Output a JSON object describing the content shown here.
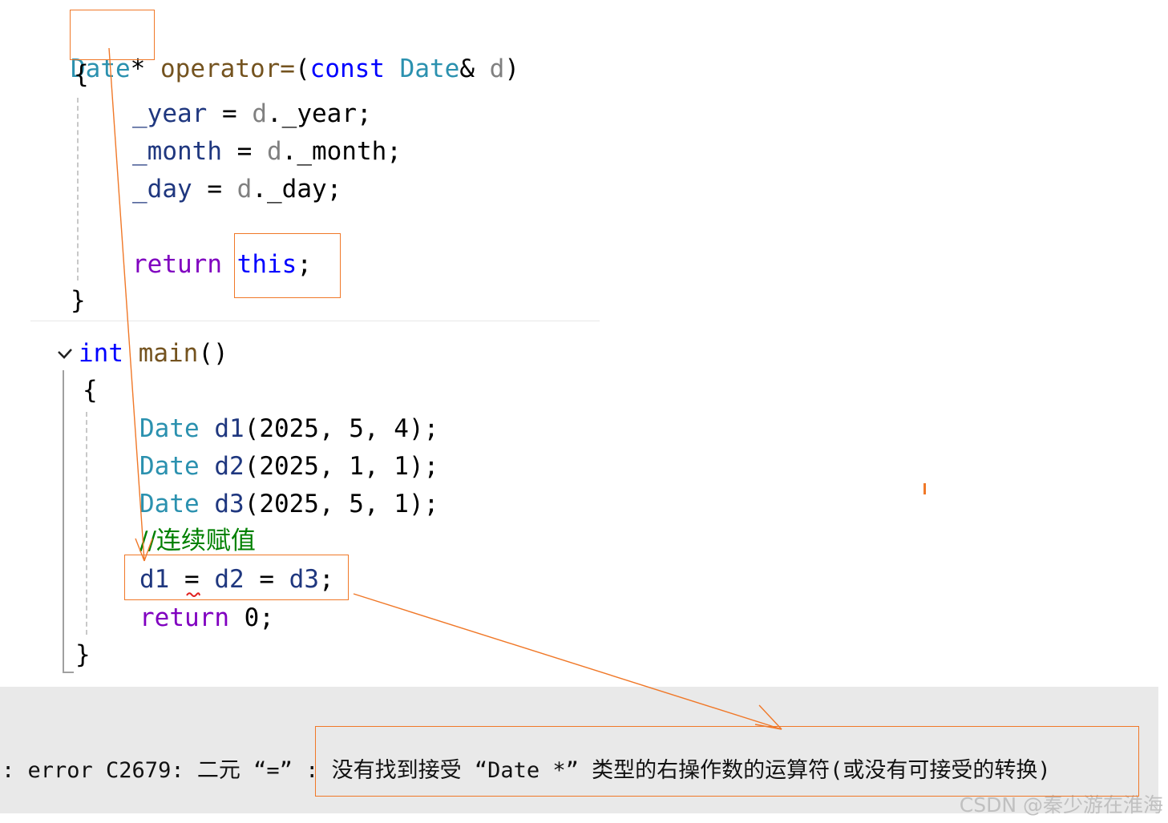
{
  "operator_func": {
    "ret_type": "Date",
    "star": "*",
    "name": "operator=",
    "open_paren": "(",
    "param_kw": "const",
    "param_type": "Date",
    "amp": "&",
    "param_name": "d",
    "close_paren": ")",
    "open_brace": "{",
    "close_brace": "}",
    "lines": [
      {
        "lhs": "_year",
        "op": " = ",
        "obj": "d",
        "member": "._year;"
      },
      {
        "lhs": "_month",
        "op": " = ",
        "obj": "d",
        "member": "._month;"
      },
      {
        "lhs": "_day",
        "op": " = ",
        "obj": "d",
        "member": "._day;"
      }
    ],
    "return_kw": "return",
    "return_val": "this",
    "return_semi": ";"
  },
  "main_func": {
    "collapse_icon": "chevron-down-icon",
    "ret_type": "int",
    "name": "main",
    "parens": "()",
    "open_brace": "{",
    "close_brace": "}",
    "decls": [
      {
        "type": "Date",
        "var": "d1",
        "args": "(2025, 5, 4);"
      },
      {
        "type": "Date",
        "var": "d2",
        "args": "(2025, 1, 1);"
      },
      {
        "type": "Date",
        "var": "d3",
        "args": "(2025, 5, 1);"
      }
    ],
    "comment": "//连续赋值",
    "assign_line": {
      "a": "d1",
      "op1": " = ",
      "b": "d2",
      "op2": " = ",
      "c": "d3",
      "semi": ";"
    },
    "return_kw": "return",
    "return_val": " 0;"
  },
  "error": {
    "prefix": ": error C2679: 二元 “=” : ",
    "message": "没有找到接受 “Date *” 类型的右操作数的运算符(或没有可接受的转换)"
  },
  "watermark": "CSDN @秦少游在淮海",
  "colors": {
    "annotation": "#f07828",
    "keyword": "#8000c0",
    "type": "#2b91af",
    "comment": "#008000"
  }
}
